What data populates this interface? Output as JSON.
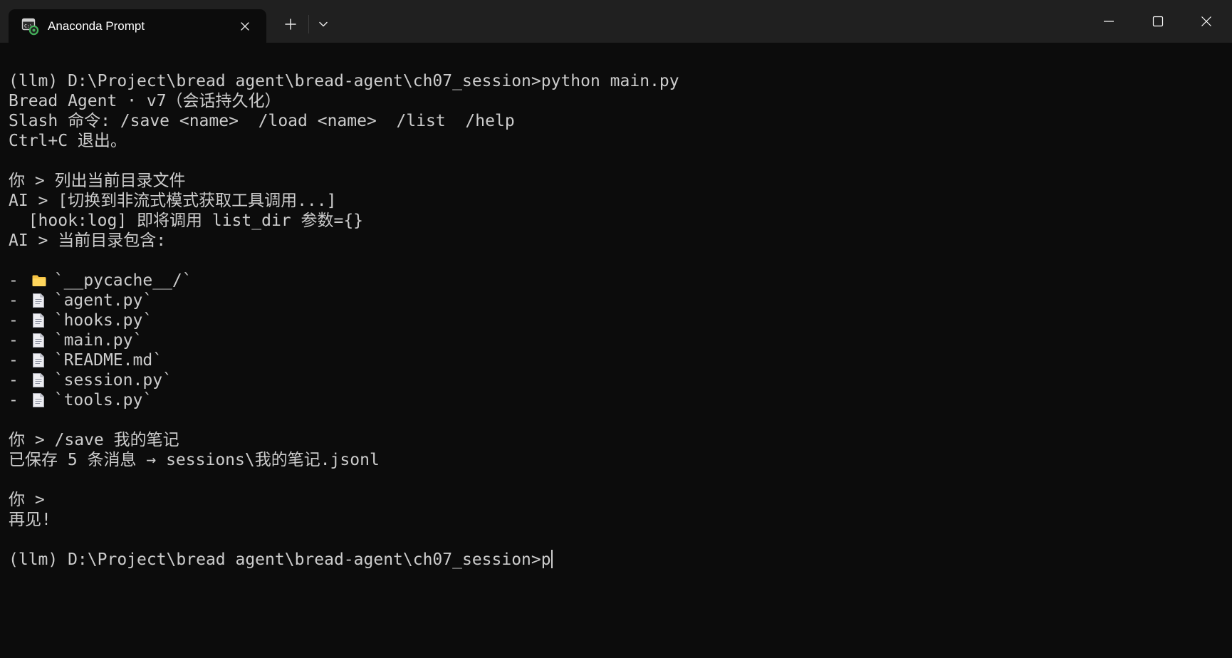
{
  "window": {
    "tab_title": "Anaconda Prompt",
    "tab_icon": "terminal-icon",
    "controls": {
      "new_tab": "plus-icon",
      "dropdown": "chevron-down-icon",
      "minimize": "minimize-icon",
      "maximize": "maximize-icon",
      "close": "close-icon"
    }
  },
  "terminal": {
    "colors": {
      "background": "#0c0c0c",
      "foreground": "#cccccc",
      "folder_icon": "#f5c242",
      "file_icon": "#eeeef2"
    },
    "header_lines": [
      "(llm) D:\\Project\\bread agent\\bread-agent\\ch07_session>python main.py",
      "Bread Agent · v7（会话持久化）",
      "Slash 命令: /save <name>  /load <name>  /list  /help",
      "Ctrl+C 退出。",
      "",
      "你 > 列出当前目录文件",
      "AI > [切换到非流式模式获取工具调用...]",
      "  [hook:log] 即将调用 list_dir 参数={}",
      "AI > 当前目录包含:",
      ""
    ],
    "listing": [
      {
        "bullet": "-",
        "icon": "folder-icon",
        "name": "`__pycache__/`"
      },
      {
        "bullet": "-",
        "icon": "file-icon",
        "name": "`agent.py`"
      },
      {
        "bullet": "-",
        "icon": "file-icon",
        "name": "`hooks.py`"
      },
      {
        "bullet": "-",
        "icon": "file-icon",
        "name": "`main.py`"
      },
      {
        "bullet": "-",
        "icon": "file-icon",
        "name": "`README.md`"
      },
      {
        "bullet": "-",
        "icon": "file-icon",
        "name": "`session.py`"
      },
      {
        "bullet": "-",
        "icon": "file-icon",
        "name": "`tools.py`"
      }
    ],
    "footer_lines": [
      "",
      "你 > /save 我的笔记",
      "已保存 5 条消息 → sessions\\我的笔记.jsonl",
      "",
      "你 >",
      "再见!",
      ""
    ],
    "prompt": "(llm) D:\\Project\\bread agent\\bread-agent\\ch07_session>",
    "current_input": "p"
  }
}
